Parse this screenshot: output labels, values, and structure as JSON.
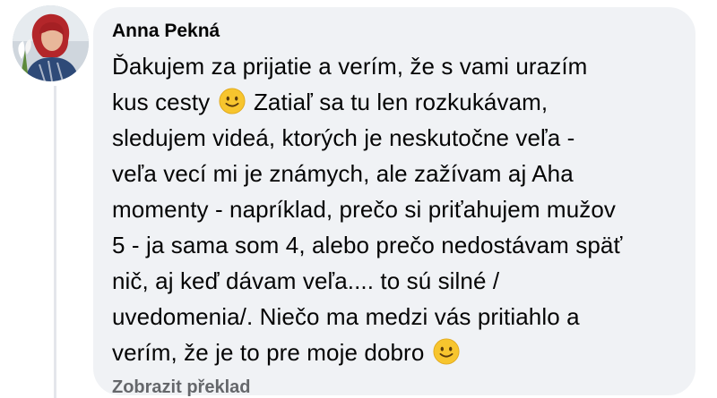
{
  "comment": {
    "author": "Anna Pekná",
    "lines": [
      "Ďakujem za prijatie a verím, že s vami  urazím",
      "kus cesty",
      "Zatiaľ sa tu len rozkukávam,",
      "sledujem videá, ktorých je neskutočne veľa -",
      "veľa vecí mi je známych, ale zažívam aj Aha",
      "momenty - napríklad, prečo si priťahujem mužov",
      "5 - ja sama som 4, alebo prečo nedostávam späť",
      "nič, aj keď dávam veľa.... to sú silné /",
      "uvedomenia/. Niečo ma medzi vás pritiahlo a",
      "verím, že je to pre moje dobro"
    ],
    "emoji_icon": "slightly-smiling-face-icon",
    "translate_label": "Zobrazit překlad"
  },
  "colors": {
    "bubble": "#f0f2f5",
    "text": "#050505",
    "secondary_text": "#65676b",
    "emoji": "#f7c52e"
  }
}
